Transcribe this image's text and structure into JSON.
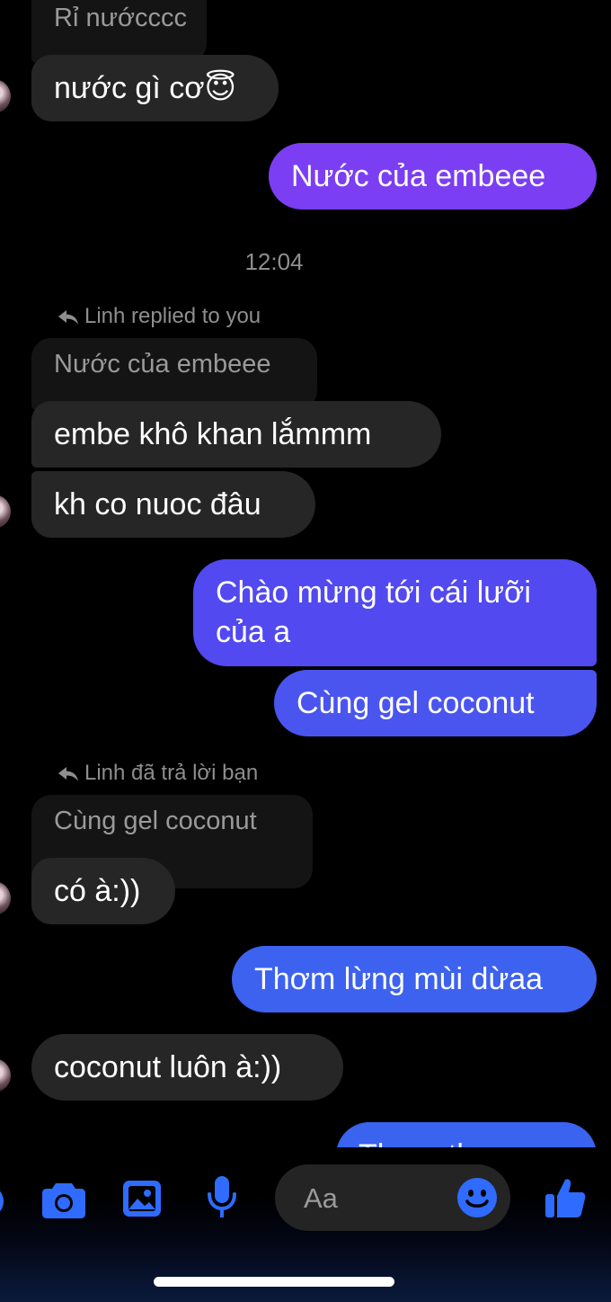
{
  "messages": [
    {
      "quote": "Rỉ nướcccc",
      "text": "nước gì cơ😇"
    },
    {
      "text": "Nước của embeee"
    },
    {
      "timestamp": "12:04"
    },
    {
      "replied_label": "Linh replied to you",
      "quote": "Nước của embeee",
      "text": "embe khô khan lắmmm"
    },
    {
      "text": "kh co nuoc đâu"
    },
    {
      "line1": "Chào mừng tới cái lưỡi",
      "line2": "của a"
    },
    {
      "text": "Cùng gel coconut"
    },
    {
      "replied_label": "Linh đã trả lời bạn",
      "quote": "Cùng gel coconut",
      "text": "có à:))"
    },
    {
      "text": "Thơm lừng mùi dừaa"
    },
    {
      "text": "coconut luôn à:))"
    },
    {
      "text": "Thơm thực sự"
    }
  ],
  "composer": {
    "placeholder": "Aa"
  },
  "toolbar": {
    "icons": [
      "more-icon",
      "camera-icon",
      "gallery-icon",
      "microphone-icon",
      "emoji-icon",
      "like-icon"
    ]
  },
  "colors": {
    "background": "#000000",
    "incoming_bubble": "#262626",
    "outgoing_purple": "#7a3ff0",
    "outgoing_blue": "#3b62ee",
    "accent": "#2f6bff"
  }
}
